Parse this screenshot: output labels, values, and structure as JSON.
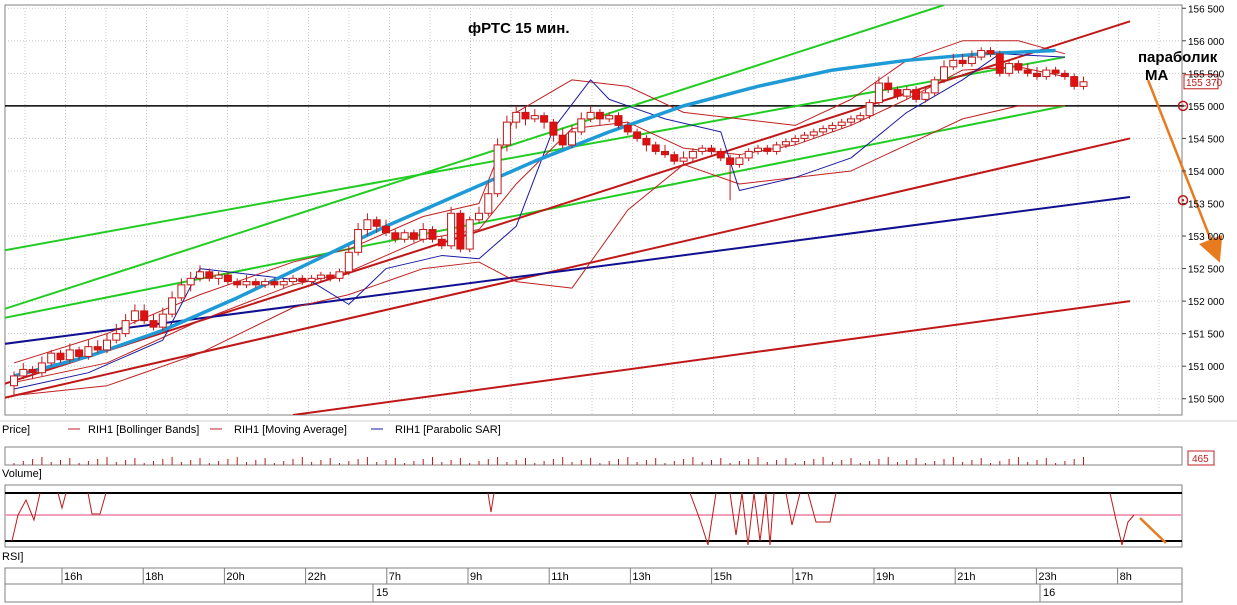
{
  "chart_data": {
    "type": "candlestick",
    "title": "фРТС   15 мин.",
    "ylim": [
      150250,
      156550
    ],
    "y_ticks": [
      150500,
      151000,
      151500,
      152000,
      152500,
      153000,
      153500,
      154000,
      154500,
      155000,
      155500,
      156000,
      156500
    ],
    "y_tick_labels": [
      "150 500",
      "151 000",
      "151 500",
      "152 000",
      "152 500",
      "153 000",
      "153 500",
      "154 000",
      "154 500",
      "155 000",
      "155 500",
      "156 000",
      "156 500"
    ],
    "last_price_label": "155 370",
    "level_marks": [
      155000,
      153550
    ],
    "x_time_labels": [
      "16h",
      "18h",
      "20h",
      "22h",
      "7h",
      "9h",
      "11h",
      "13h",
      "15h",
      "17h",
      "19h",
      "21h",
      "23h",
      "8h"
    ],
    "x_date_labels": [
      "15",
      "16"
    ],
    "annotations": [
      "параболик",
      "MA"
    ],
    "panel_labels": {
      "price": "Price]",
      "volume": "Volume]",
      "rsi": "RSI]"
    },
    "legend": [
      {
        "label": "RIH1 [Bollinger Bands]",
        "color": "#c02020"
      },
      {
        "label": "RIH1 [Moving Average]",
        "color": "#c02020"
      },
      {
        "label": "RIH1 [Parabolic SAR]",
        "color": "#1a1aa0"
      }
    ],
    "volume_label": "465",
    "candles": [
      [
        150700,
        150850,
        150550,
        150920
      ],
      [
        150850,
        150950,
        150800,
        151050
      ],
      [
        150950,
        150900,
        150800,
        151000
      ],
      [
        150900,
        151050,
        150850,
        151150
      ],
      [
        151050,
        151200,
        151000,
        151250
      ],
      [
        151200,
        151100,
        151050,
        151250
      ],
      [
        151100,
        151250,
        151050,
        151350
      ],
      [
        151250,
        151150,
        151100,
        151300
      ],
      [
        151150,
        151300,
        151100,
        151400
      ],
      [
        151300,
        151250,
        151200,
        151400
      ],
      [
        151250,
        151400,
        151200,
        151500
      ],
      [
        151400,
        151500,
        151350,
        151650
      ],
      [
        151500,
        151700,
        151450,
        151800
      ],
      [
        151700,
        151850,
        151650,
        151950
      ],
      [
        151850,
        151700,
        151650,
        151950
      ],
      [
        151700,
        151600,
        151550,
        151800
      ],
      [
        151600,
        151800,
        151550,
        151900
      ],
      [
        151800,
        152050,
        151750,
        152150
      ],
      [
        152050,
        152250,
        152000,
        152350
      ],
      [
        152250,
        152350,
        152150,
        152450
      ],
      [
        152350,
        152450,
        152300,
        152550
      ],
      [
        152450,
        152350,
        152300,
        152500
      ],
      [
        152350,
        152400,
        152250,
        152450
      ],
      [
        152400,
        152300,
        152250,
        152450
      ],
      [
        152300,
        152250,
        152200,
        152350
      ],
      [
        152250,
        152300,
        152200,
        152400
      ],
      [
        152300,
        152250,
        152200,
        152350
      ],
      [
        152250,
        152300,
        152200,
        152350
      ],
      [
        152300,
        152250,
        152200,
        152350
      ],
      [
        152250,
        152300,
        152200,
        152350
      ],
      [
        152300,
        152350,
        152250,
        152400
      ],
      [
        152350,
        152300,
        152250,
        152400
      ],
      [
        152300,
        152350,
        152250,
        152400
      ],
      [
        152350,
        152400,
        152300,
        152450
      ],
      [
        152400,
        152350,
        152300,
        152450
      ],
      [
        152350,
        152450,
        152300,
        152500
      ],
      [
        152450,
        152750,
        152400,
        152850
      ],
      [
        152750,
        153100,
        152700,
        153200
      ],
      [
        153100,
        153250,
        153000,
        153350
      ],
      [
        153250,
        153150,
        153050,
        153300
      ],
      [
        153150,
        153050,
        153000,
        153250
      ],
      [
        153050,
        152950,
        152900,
        153100
      ],
      [
        152950,
        153050,
        152900,
        153100
      ],
      [
        153050,
        152950,
        152900,
        153100
      ],
      [
        152950,
        153100,
        152900,
        153200
      ],
      [
        153100,
        152950,
        152900,
        153150
      ],
      [
        152950,
        152850,
        152800,
        153000
      ],
      [
        152850,
        153350,
        152800,
        153450
      ],
      [
        153350,
        152800,
        152750,
        153400
      ],
      [
        152800,
        153250,
        152750,
        153300
      ],
      [
        153250,
        153350,
        153200,
        153450
      ],
      [
        153350,
        153650,
        153300,
        153850
      ],
      [
        153650,
        154400,
        153600,
        154500
      ],
      [
        154400,
        154750,
        154300,
        154850
      ],
      [
        154750,
        154900,
        154650,
        155000
      ],
      [
        154900,
        154800,
        154700,
        155000
      ],
      [
        154800,
        154850,
        154750,
        154950
      ],
      [
        154850,
        154750,
        154650,
        154900
      ],
      [
        154750,
        154550,
        154450,
        154800
      ],
      [
        154550,
        154400,
        154350,
        154650
      ],
      [
        154400,
        154600,
        154350,
        154700
      ],
      [
        154600,
        154800,
        154550,
        154900
      ],
      [
        154800,
        154900,
        154750,
        155000
      ],
      [
        154900,
        154800,
        154700,
        154950
      ],
      [
        154800,
        154850,
        154750,
        154900
      ],
      [
        154850,
        154700,
        154650,
        154900
      ],
      [
        154700,
        154600,
        154550,
        154750
      ],
      [
        154600,
        154500,
        154450,
        154650
      ],
      [
        154500,
        154400,
        154300,
        154550
      ],
      [
        154400,
        154300,
        154250,
        154450
      ],
      [
        154300,
        154250,
        154200,
        154400
      ],
      [
        154250,
        154150,
        154100,
        154300
      ],
      [
        154150,
        154200,
        154100,
        154300
      ],
      [
        154200,
        154300,
        154150,
        154350
      ],
      [
        154300,
        154350,
        154250,
        154400
      ],
      [
        154350,
        154300,
        154250,
        154400
      ],
      [
        154300,
        154200,
        154150,
        154350
      ],
      [
        154200,
        154100,
        153550,
        154250
      ],
      [
        154100,
        154200,
        154050,
        154250
      ],
      [
        154200,
        154300,
        154150,
        154350
      ],
      [
        154300,
        154350,
        154250,
        154400
      ],
      [
        154350,
        154300,
        154250,
        154400
      ],
      [
        154300,
        154400,
        154250,
        154450
      ],
      [
        154400,
        154450,
        154350,
        154500
      ],
      [
        154450,
        154500,
        154400,
        154550
      ],
      [
        154500,
        154550,
        154450,
        154600
      ],
      [
        154550,
        154600,
        154500,
        154650
      ],
      [
        154600,
        154650,
        154550,
        154700
      ],
      [
        154650,
        154700,
        154600,
        154750
      ],
      [
        154700,
        154750,
        154650,
        154800
      ],
      [
        154750,
        154800,
        154700,
        154850
      ],
      [
        154800,
        154850,
        154750,
        154900
      ],
      [
        154850,
        155050,
        154800,
        155100
      ],
      [
        155050,
        155350,
        155000,
        155450
      ],
      [
        155350,
        155250,
        155200,
        155450
      ],
      [
        155250,
        155150,
        155100,
        155300
      ],
      [
        155150,
        155250,
        155100,
        155300
      ],
      [
        155250,
        155100,
        155050,
        155300
      ],
      [
        155100,
        155200,
        155050,
        155300
      ],
      [
        155200,
        155400,
        155150,
        155450
      ],
      [
        155400,
        155600,
        155350,
        155700
      ],
      [
        155600,
        155700,
        155550,
        155800
      ],
      [
        155700,
        155650,
        155600,
        155800
      ],
      [
        155650,
        155750,
        155600,
        155850
      ],
      [
        155750,
        155850,
        155700,
        155900
      ],
      [
        155850,
        155800,
        155750,
        155900
      ],
      [
        155800,
        155500,
        155450,
        155850
      ],
      [
        155500,
        155650,
        155450,
        155700
      ],
      [
        155650,
        155550,
        155500,
        155700
      ],
      [
        155550,
        155500,
        155450,
        155650
      ],
      [
        155500,
        155450,
        155400,
        155600
      ],
      [
        155450,
        155550,
        155400,
        155600
      ],
      [
        155550,
        155500,
        155450,
        155600
      ],
      [
        155500,
        155450,
        155400,
        155550
      ],
      [
        155450,
        155300,
        155250,
        155500
      ],
      [
        155300,
        155370,
        155250,
        155450
      ]
    ],
    "parabolic_curve": [
      [
        0,
        150850
      ],
      [
        8,
        151150
      ],
      [
        16,
        151550
      ],
      [
        24,
        152050
      ],
      [
        32,
        152600
      ],
      [
        40,
        153150
      ],
      [
        48,
        153650
      ],
      [
        56,
        154150
      ],
      [
        64,
        154600
      ],
      [
        72,
        155000
      ],
      [
        80,
        155300
      ],
      [
        88,
        155550
      ],
      [
        96,
        155700
      ],
      [
        104,
        155800
      ],
      [
        112,
        155850
      ]
    ],
    "bollinger_upper": [
      [
        0,
        151050
      ],
      [
        10,
        151500
      ],
      [
        20,
        152100
      ],
      [
        30,
        152600
      ],
      [
        36,
        152800
      ],
      [
        44,
        153300
      ],
      [
        50,
        153500
      ],
      [
        54,
        154900
      ],
      [
        60,
        155400
      ],
      [
        66,
        155300
      ],
      [
        72,
        154900
      ],
      [
        78,
        154800
      ],
      [
        84,
        154700
      ],
      [
        90,
        155100
      ],
      [
        96,
        155700
      ],
      [
        102,
        156000
      ],
      [
        108,
        156000
      ],
      [
        113,
        155800
      ]
    ],
    "bollinger_lower": [
      [
        0,
        150550
      ],
      [
        10,
        150700
      ],
      [
        20,
        151200
      ],
      [
        30,
        151900
      ],
      [
        36,
        152100
      ],
      [
        44,
        152500
      ],
      [
        50,
        152600
      ],
      [
        54,
        152300
      ],
      [
        60,
        152200
      ],
      [
        66,
        153400
      ],
      [
        72,
        154100
      ],
      [
        78,
        153800
      ],
      [
        84,
        153900
      ],
      [
        90,
        154000
      ],
      [
        96,
        154400
      ],
      [
        102,
        154800
      ],
      [
        108,
        155000
      ],
      [
        113,
        155000
      ]
    ],
    "moving_average": [
      [
        0,
        150750
      ],
      [
        10,
        151050
      ],
      [
        20,
        151700
      ],
      [
        30,
        152250
      ],
      [
        36,
        152450
      ],
      [
        44,
        152950
      ],
      [
        50,
        153100
      ],
      [
        54,
        153800
      ],
      [
        60,
        154650
      ],
      [
        66,
        154750
      ],
      [
        72,
        154350
      ],
      [
        78,
        154250
      ],
      [
        84,
        154400
      ],
      [
        90,
        154700
      ],
      [
        96,
        155100
      ],
      [
        102,
        155550
      ],
      [
        108,
        155600
      ],
      [
        113,
        155450
      ]
    ],
    "parabolic_sar": [
      [
        0,
        150650
      ],
      [
        8,
        150900
      ],
      [
        16,
        151400
      ],
      [
        20,
        152500
      ],
      [
        26,
        152400
      ],
      [
        32,
        152300
      ],
      [
        36,
        151950
      ],
      [
        40,
        152500
      ],
      [
        46,
        152700
      ],
      [
        50,
        152650
      ],
      [
        54,
        153150
      ],
      [
        58,
        154650
      ],
      [
        62,
        155400
      ],
      [
        64,
        155100
      ],
      [
        70,
        154800
      ],
      [
        76,
        154600
      ],
      [
        78,
        153700
      ],
      [
        84,
        153900
      ],
      [
        90,
        154200
      ],
      [
        96,
        154900
      ],
      [
        102,
        155400
      ],
      [
        106,
        155800
      ],
      [
        113,
        155750
      ]
    ],
    "trend_lines": [
      {
        "color": "#22cc22",
        "points": [
          [
            -6,
            151650
          ],
          [
            100,
            156550
          ]
        ]
      },
      {
        "color": "#22cc22",
        "points": [
          [
            -6,
            152650
          ],
          [
            113,
            155750
          ]
        ]
      },
      {
        "color": "#22cc22",
        "points": [
          [
            -6,
            151600
          ],
          [
            113,
            155000
          ]
        ]
      },
      {
        "color": "#c01818",
        "points": [
          [
            -6,
            150500
          ],
          [
            120,
            156300
          ]
        ]
      },
      {
        "color": "#c01818",
        "points": [
          [
            -6,
            150350
          ],
          [
            120,
            154500
          ]
        ]
      },
      {
        "color": "#c01818",
        "points": [
          [
            30,
            150250
          ],
          [
            120,
            152000
          ]
        ]
      },
      {
        "color": "#101090",
        "points": [
          [
            -6,
            151250
          ],
          [
            120,
            153600
          ]
        ]
      }
    ],
    "black_level": 155000,
    "rsi": {
      "ylim": [
        0,
        100
      ],
      "mid_level": 50,
      "upper_level": 100,
      "lower_level": 0
    }
  }
}
